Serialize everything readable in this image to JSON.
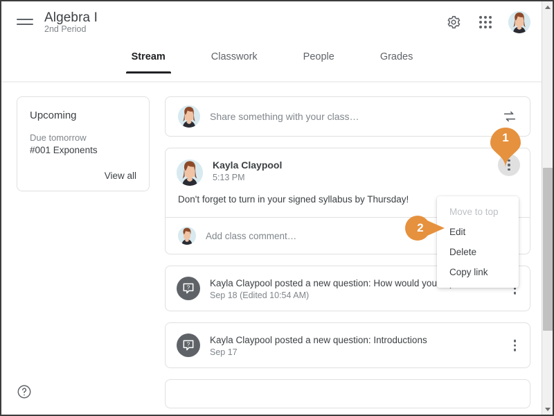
{
  "header": {
    "menu_icon": "hamburger-menu-icon",
    "course_title": "Algebra I",
    "course_section": "2nd Period",
    "settings_icon": "gear-icon",
    "apps_icon": "apps-grid-icon",
    "avatar_icon": "user-avatar"
  },
  "tabs": [
    {
      "label": "Stream",
      "active": true
    },
    {
      "label": "Classwork",
      "active": false
    },
    {
      "label": "People",
      "active": false
    },
    {
      "label": "Grades",
      "active": false
    }
  ],
  "upcoming": {
    "title": "Upcoming",
    "due_label": "Due tomorrow",
    "assignment": "#001 Exponents",
    "view_all_label": "View all"
  },
  "share_box": {
    "placeholder": "Share something with your class…",
    "reuse_icon": "reuse-post-icon",
    "avatar_icon": "user-avatar"
  },
  "post": {
    "author": "Kayla Claypool",
    "time": "5:13 PM",
    "body": "Don't forget to turn in your signed syllabus by Thursday!",
    "comment_placeholder": "Add class comment…",
    "kebab_icon": "more-options-icon",
    "avatar_icon": "user-avatar"
  },
  "post_menu": {
    "items": [
      {
        "label": "Move to top",
        "disabled": true
      },
      {
        "label": "Edit",
        "disabled": false
      },
      {
        "label": "Delete",
        "disabled": false
      },
      {
        "label": "Copy link",
        "disabled": false
      }
    ]
  },
  "question_posts": [
    {
      "title": "Kayla Claypool posted a new question: How would you explain …",
      "date": "Sep 18 (Edited 10:54 AM)",
      "icon": "question-bubble-icon",
      "kebab_icon": "more-options-icon"
    },
    {
      "title": "Kayla Claypool posted a new question: Introductions",
      "date": "Sep 17",
      "icon": "question-bubble-icon",
      "kebab_icon": "more-options-icon"
    }
  ],
  "help": {
    "icon": "help-circle-icon"
  },
  "callouts": [
    {
      "number": "1",
      "target": "post-more-options-button"
    },
    {
      "number": "2",
      "target": "menu-item-edit"
    }
  ],
  "scrollbar": {
    "up_arrow_icon": "scroll-up-arrow-icon",
    "down_arrow_icon": "scroll-down-arrow-icon"
  },
  "colors": {
    "callout_orange": "#e6913e",
    "accent_dark": "#202124",
    "text_primary": "#3c4043",
    "text_secondary": "#80868b",
    "border": "#e0e0e0"
  }
}
